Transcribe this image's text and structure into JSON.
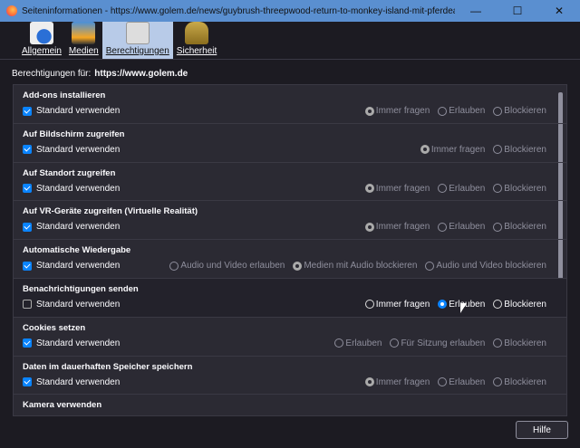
{
  "window": {
    "title": "Seiteninformationen - https://www.golem.de/news/guybrush-threepwood-return-to-monkey-island-mit-pferdeausruestu...",
    "minimize": "—",
    "maximize": "☐",
    "close": "✕"
  },
  "tabs": [
    {
      "label": "Allgemein",
      "icon": "info-icon"
    },
    {
      "label": "Medien",
      "icon": "media-icon"
    },
    {
      "label": "Berechtigungen",
      "icon": "permissions-icon",
      "active": true
    },
    {
      "label": "Sicherheit",
      "icon": "lock-icon"
    }
  ],
  "permissions_for": {
    "label": "Berechtigungen für:",
    "site": "https://www.golem.de"
  },
  "default_label": "Standard verwenden",
  "rows": [
    {
      "title": "Add-ons installieren",
      "default": true,
      "options": [
        "Immer fragen",
        "Erlauben",
        "Blockieren"
      ],
      "selected": 0
    },
    {
      "title": "Auf Bildschirm zugreifen",
      "default": true,
      "options": [
        "Immer fragen",
        "Blockieren"
      ],
      "selected": 0
    },
    {
      "title": "Auf Standort zugreifen",
      "default": true,
      "options": [
        "Immer fragen",
        "Erlauben",
        "Blockieren"
      ],
      "selected": 0
    },
    {
      "title": "Auf VR-Geräte zugreifen (Virtuelle Realität)",
      "default": true,
      "options": [
        "Immer fragen",
        "Erlauben",
        "Blockieren"
      ],
      "selected": 0
    },
    {
      "title": "Automatische Wiedergabe",
      "default": true,
      "options": [
        "Audio und Video erlauben",
        "Medien mit Audio blockieren",
        "Audio und Video blockieren"
      ],
      "selected": 1
    },
    {
      "title": "Benachrichtigungen senden",
      "default": false,
      "options": [
        "Immer fragen",
        "Erlauben",
        "Blockieren"
      ],
      "selected": 1
    },
    {
      "title": "Cookies setzen",
      "default": true,
      "options": [
        "Erlauben",
        "Für Sitzung erlauben",
        "Blockieren"
      ],
      "selected": -1
    },
    {
      "title": "Daten im dauerhaften Speicher speichern",
      "default": true,
      "options": [
        "Immer fragen",
        "Erlauben",
        "Blockieren"
      ],
      "selected": 0
    },
    {
      "title": "Kamera verwenden"
    }
  ],
  "help_label": "Hilfe"
}
